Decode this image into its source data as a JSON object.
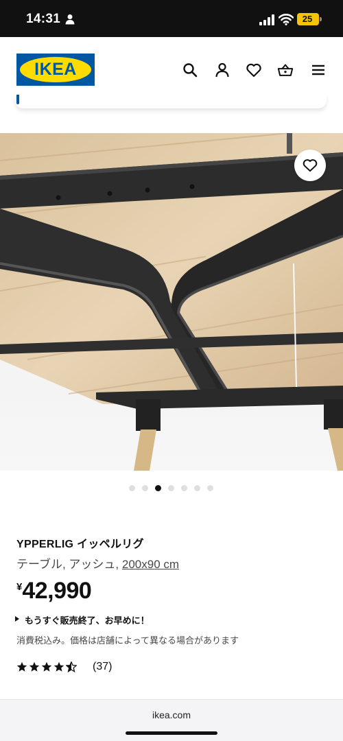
{
  "status_bar": {
    "time": "14:31",
    "battery": "25",
    "icons": [
      "person-icon",
      "signal-icon",
      "wifi-icon",
      "battery-icon"
    ]
  },
  "header": {
    "logo_text": "IKEA",
    "icons": [
      "search-icon",
      "account-icon",
      "heart-icon",
      "cart-icon",
      "menu-icon"
    ],
    "colors": {
      "brand_blue": "#0058a3",
      "brand_yellow": "#ffdb00"
    }
  },
  "gallery": {
    "image_description": "ash table underside with black legs",
    "dot_count": 7,
    "active_dot": 3,
    "favourite_icon": "heart-icon"
  },
  "product": {
    "name": "YPPERLIG イッペルリグ",
    "type": "テーブル, アッシュ,",
    "size": "200x90 cm",
    "currency": "¥",
    "price": "42,990",
    "alert": "もうすぐ販売終了、お早めに！",
    "tax_note": "消費税込み。価格は店舗によって異なる場合があります",
    "rating_stars": 4.5,
    "rating_count": "(37)"
  },
  "browser": {
    "url": "ikea.com"
  }
}
